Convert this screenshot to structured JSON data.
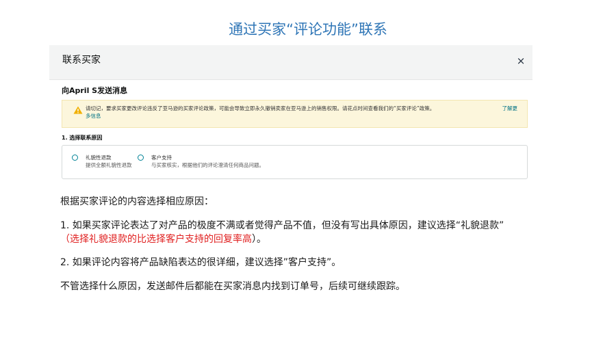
{
  "slide_title": "通过买家“评论功能”联系",
  "modal": {
    "title": "联系买家",
    "close_symbol": "×",
    "send_to": "向April S发送消息",
    "alert": {
      "text": "请切记，要求买家更改评论违反了亚马逊的买家评论政策，可能会导致立即永久撤销卖家在亚马逊上的销售权限。请花点时间查看我们的“买家评论”政策。",
      "link_part1": "了解更",
      "link_part2": "多信息"
    },
    "step_label": "1. 选择联系原因",
    "reasons": [
      {
        "title": "礼貌性退款",
        "desc": "提供全额礼貌性退款"
      },
      {
        "title": "客户支持",
        "desc": "与买家核实，根据他们的评论澄清任何商品问题。"
      }
    ]
  },
  "body": {
    "intro": "根据买家评论的内容选择相应原因：",
    "point1_line1": "1. 如果买家评论表达了对产品的极度不满或者觉得产品不值，但没有写出具体原因，建议选择“礼貌退款”",
    "point1_open": "（",
    "point1_red": "选择礼貌退款的比选择客户支持的回复率高",
    "point1_close": "）。",
    "point2": "2. 如果评论内容将产品缺陷表达的很详细，建议选择”客户支持”。",
    "closing": "不管选择什么原因，发送邮件后都能在买家消息内找到订单号，后续可继续跟踪。"
  },
  "colors": {
    "title_blue": "#2e75b6",
    "highlight_red": "#e02020",
    "alert_bg": "#fcf6dc",
    "link_teal": "#007185"
  }
}
